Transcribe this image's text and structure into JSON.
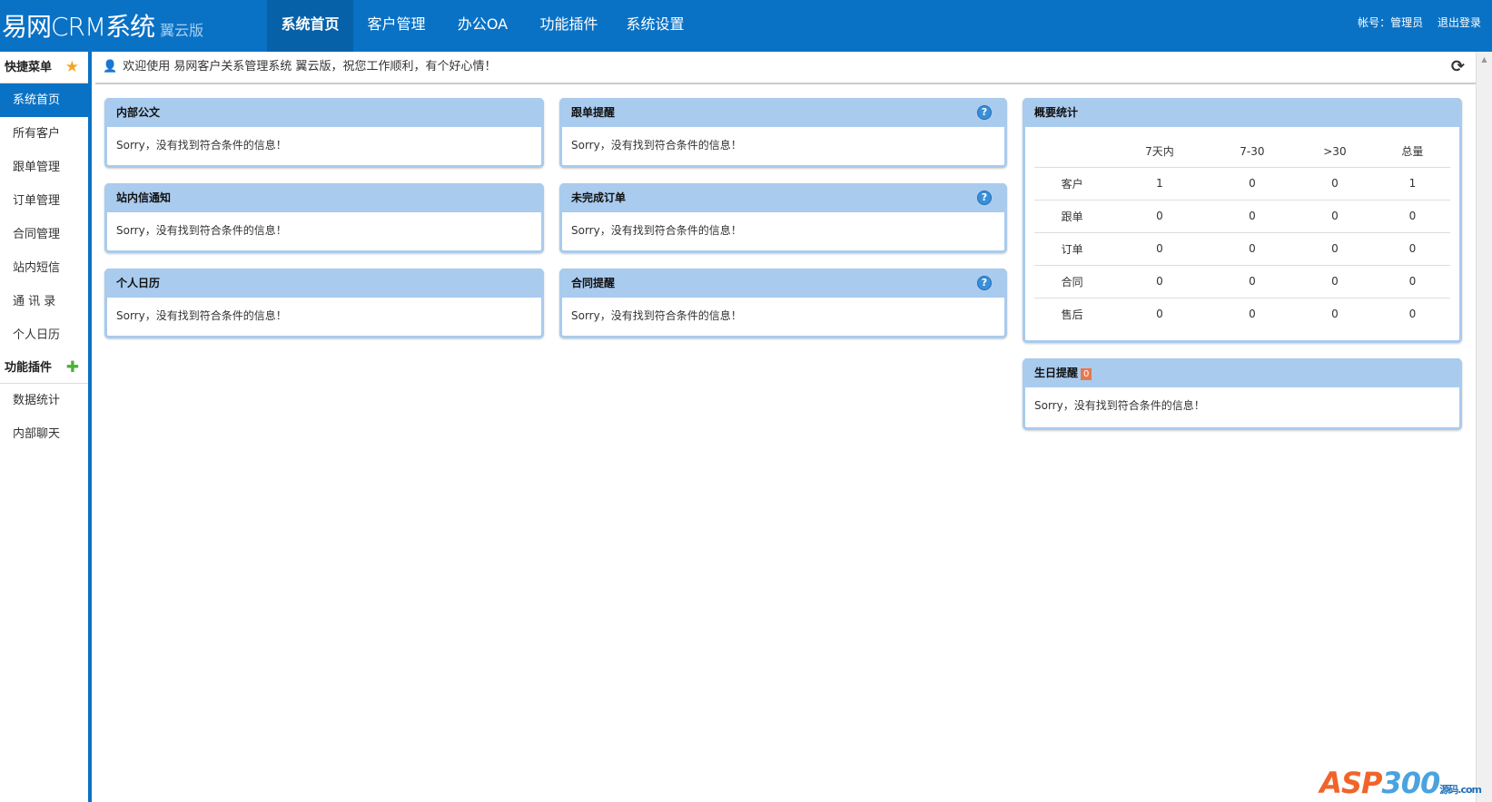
{
  "header": {
    "logo": "易网CRM系统",
    "edition": "翼云版",
    "tabs": [
      "系统首页",
      "客户管理",
      "办公OA",
      "功能插件",
      "系统设置"
    ],
    "active_tab": 0,
    "account": "帐号：管理员",
    "logout": "退出登录"
  },
  "sidebar": {
    "quick_title": "快捷菜单",
    "quick_items": [
      "系统首页",
      "所有客户",
      "跟单管理",
      "订单管理",
      "合同管理",
      "站内短信",
      "通 讯 录",
      "个人日历"
    ],
    "plugin_title": "功能插件",
    "plugin_items": [
      "数据统计",
      "内部聊天"
    ]
  },
  "welcome": "欢迎使用 易网客户关系管理系统 翼云版，祝您工作顺利，有个好心情！",
  "empty_msg": "Sorry，没有找到符合条件的信息！",
  "panels": {
    "p1": "内部公文",
    "p2": "跟单提醒",
    "p3": "站内信通知",
    "p4": "未完成订单",
    "p5": "个人日历",
    "p6": "合同提醒"
  },
  "stats": {
    "title": "概要统计",
    "columns": [
      "7天内",
      "7-30",
      ">30",
      "总量"
    ],
    "rows": [
      {
        "label": "客户",
        "values": [
          "1",
          "0",
          "0",
          "1"
        ]
      },
      {
        "label": "跟单",
        "values": [
          "0",
          "0",
          "0",
          "0"
        ]
      },
      {
        "label": "订单",
        "values": [
          "0",
          "0",
          "0",
          "0"
        ]
      },
      {
        "label": "合同",
        "values": [
          "0",
          "0",
          "0",
          "0"
        ]
      },
      {
        "label": "售后",
        "values": [
          "0",
          "0",
          "0",
          "0"
        ]
      }
    ]
  },
  "birthday": {
    "title": "生日提醒",
    "count": "0"
  },
  "watermark": "ASP300源码.com"
}
